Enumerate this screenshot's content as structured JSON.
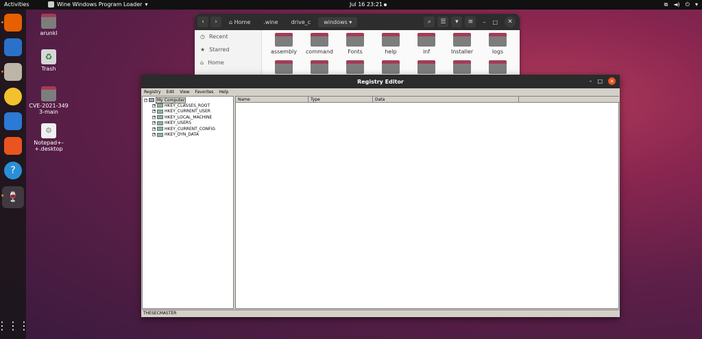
{
  "topbar": {
    "activities": "Activities",
    "app_name": "Wine Windows Program Loader",
    "clock": "Jul 16  23:21"
  },
  "desktop_icons": [
    {
      "label": "arunkl",
      "icon": "home-folder-icon"
    },
    {
      "label": "Trash",
      "icon": "trash-icon"
    },
    {
      "label": "CVE-2021-3493-main",
      "icon": "folder-icon"
    },
    {
      "label": "Notepad+-+.desktop",
      "icon": "desktop-file-icon"
    }
  ],
  "dock": [
    {
      "name": "firefox",
      "color": "#e66000"
    },
    {
      "name": "thunderbird",
      "color": "#2a72c9"
    },
    {
      "name": "files",
      "color": "#bdb6a8"
    },
    {
      "name": "rhythmbox",
      "color": "#f2c12e"
    },
    {
      "name": "writer",
      "color": "#2a7ad6"
    },
    {
      "name": "software",
      "color": "#e95420"
    },
    {
      "name": "help",
      "color": "#2a8fd6"
    },
    {
      "name": "wine",
      "color": "#cfcfcf"
    }
  ],
  "file_manager": {
    "breadcrumbs": [
      "Home",
      ".wine",
      "drive_c",
      "windows"
    ],
    "sidebar": [
      "Recent",
      "Starred",
      "Home"
    ],
    "folders": [
      "assembly",
      "command",
      "Fonts",
      "help",
      "inf",
      "Installer",
      "logs",
      "",
      "",
      "",
      "",
      "",
      "",
      ""
    ]
  },
  "registry": {
    "title": "Registry Editor",
    "menu": [
      "Registry",
      "Edit",
      "View",
      "Favorites",
      "Help"
    ],
    "root": "My Computer",
    "hives": [
      "HKEY_CLASSES_ROOT",
      "HKEY_CURRENT_USER",
      "HKEY_LOCAL_MACHINE",
      "HKEY_USERS",
      "HKEY_CURRENT_CONFIG",
      "HKEY_DYN_DATA"
    ],
    "columns": [
      "Name",
      "Type",
      "Data"
    ],
    "status": "THESECMASTER"
  },
  "colors": {
    "accent": "#e95420",
    "folder": "#a33c56"
  }
}
